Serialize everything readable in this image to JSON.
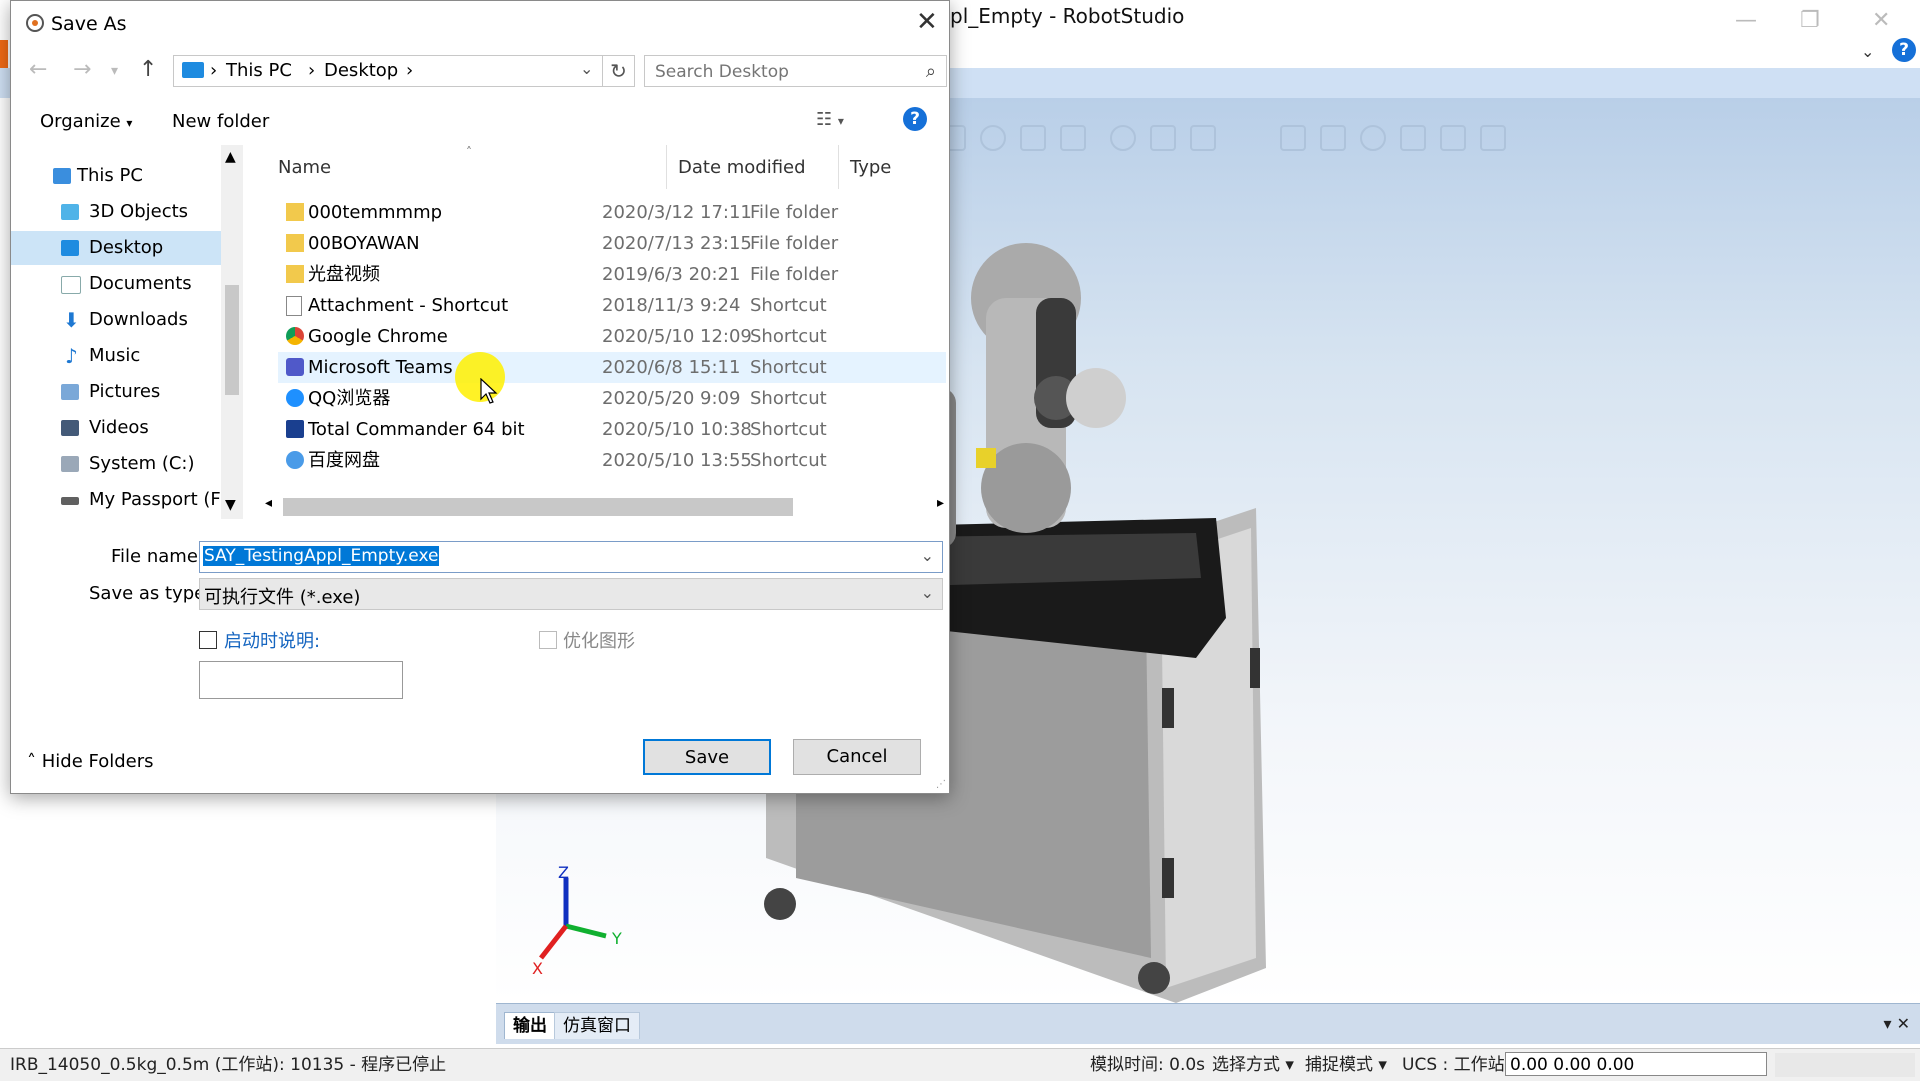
{
  "app": {
    "title": "pl_Empty - RobotStudio",
    "window_controls": {
      "minimize": "—",
      "restore": "❐",
      "close": "✕"
    }
  },
  "dialog": {
    "title": "Save As",
    "address": {
      "crumbs": [
        "This PC",
        "Desktop"
      ]
    },
    "search": {
      "placeholder": "Search Desktop"
    },
    "commands": {
      "organize": "Organize",
      "new_folder": "New folder"
    },
    "nav_items": [
      {
        "label": "This PC",
        "icon": "pc-icon",
        "selected": false
      },
      {
        "label": "3D Objects",
        "icon": "3d-objects-icon",
        "selected": false
      },
      {
        "label": "Desktop",
        "icon": "desktop-icon",
        "selected": true
      },
      {
        "label": "Documents",
        "icon": "documents-icon",
        "selected": false
      },
      {
        "label": "Downloads",
        "icon": "downloads-icon",
        "selected": false
      },
      {
        "label": "Music",
        "icon": "music-icon",
        "selected": false
      },
      {
        "label": "Pictures",
        "icon": "pictures-icon",
        "selected": false
      },
      {
        "label": "Videos",
        "icon": "videos-icon",
        "selected": false
      },
      {
        "label": "System (C:)",
        "icon": "drive-icon",
        "selected": false
      },
      {
        "label": "My Passport (F:)",
        "icon": "usb-drive-icon",
        "selected": false
      }
    ],
    "columns": {
      "name": "Name",
      "date": "Date modified",
      "type": "Type"
    },
    "files": [
      {
        "name": "000temmmmp",
        "date": "2020/3/12 17:11",
        "type": "File folder",
        "icon": "folder-icon"
      },
      {
        "name": "00BOYAWAN",
        "date": "2020/7/13 23:15",
        "type": "File folder",
        "icon": "folder-icon"
      },
      {
        "name": "光盘视频",
        "date": "2019/6/3 20:21",
        "type": "File folder",
        "icon": "folder-icon"
      },
      {
        "name": "Attachment - Shortcut",
        "date": "2018/11/3 9:24",
        "type": "Shortcut",
        "icon": "shortcut-icon"
      },
      {
        "name": "Google Chrome",
        "date": "2020/5/10 12:09",
        "type": "Shortcut",
        "icon": "chrome-icon"
      },
      {
        "name": "Microsoft Teams",
        "date": "2020/6/8 15:11",
        "type": "Shortcut",
        "icon": "teams-icon"
      },
      {
        "name": "QQ浏览器",
        "date": "2020/5/20 9:09",
        "type": "Shortcut",
        "icon": "qq-browser-icon"
      },
      {
        "name": "Total Commander 64 bit",
        "date": "2020/5/10 10:38",
        "type": "Shortcut",
        "icon": "total-commander-icon"
      },
      {
        "name": "百度网盘",
        "date": "2020/5/10 13:55",
        "type": "Shortcut",
        "icon": "baidu-netdisk-icon"
      }
    ],
    "file_name_label": "File name:",
    "file_name_value": "SAY_TestingAppl_Empty.exe",
    "save_type_label": "Save as type:",
    "save_type_value": "可执行文件 (*.exe)",
    "startup_desc_label": "启动时说明:",
    "optimize_label": "优化图形",
    "hide_folders": "Hide Folders",
    "save_label": "Save",
    "cancel_label": "Cancel"
  },
  "output_tabs": [
    "输出",
    "仿真窗口"
  ],
  "status": {
    "left": "IRB_14050_0.5kg_0.5m (工作站): 10135 - 程序已停止",
    "sim_time": "模拟时间: 0.0s",
    "select_mode": "选择方式",
    "snap_mode": "捕捉模式",
    "ucs": "UCS : 工作站",
    "coords": "0.00  0.00  0.00"
  },
  "axes": {
    "x": "X",
    "y": "Y",
    "z": "Z"
  },
  "colors": {
    "accent": "#0078d7",
    "selection": "#cce4f7",
    "hover": "#e5f3ff",
    "ribbon": "#cfe0f4",
    "cursor_highlight": "#fff000"
  }
}
